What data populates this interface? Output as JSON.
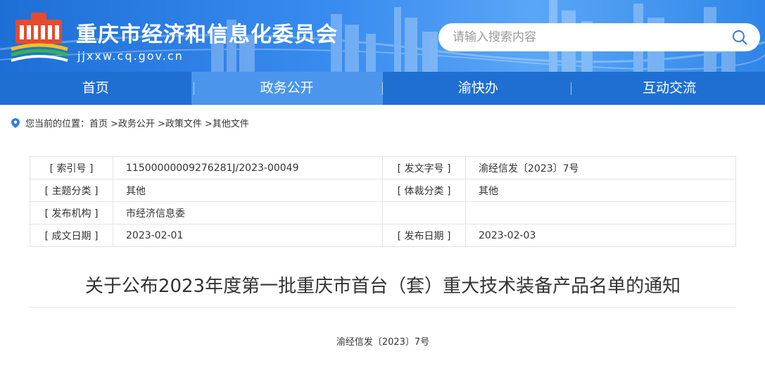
{
  "header": {
    "title": "重庆市经济和信息化委员会",
    "domain": "jjxxw.cq.gov.cn",
    "search_placeholder": "请输入搜索内容"
  },
  "nav": {
    "items": [
      {
        "label": "首页"
      },
      {
        "label": "政务公开"
      },
      {
        "label": "渝快办"
      },
      {
        "label": "互动交流"
      }
    ],
    "active_index": 1
  },
  "breadcrumb": {
    "prefix": "您当前的位置：",
    "items": [
      "首页",
      ">政务公开",
      ">政策文件",
      ">其他文件"
    ]
  },
  "info": {
    "rows": [
      {
        "label1": "[ 索引号 ]",
        "value1": "11500000009276281J/2023-00049",
        "label2": "[ 发文字号 ]",
        "value2": "渝经信发〔2023〕7号"
      },
      {
        "label1": "[ 主题分类 ]",
        "value1": "其他",
        "label2": "[ 体裁分类 ]",
        "value2": "其他"
      },
      {
        "label1": "[ 发布机构 ]",
        "value1": "市经济信息委",
        "label2": "",
        "value2": ""
      },
      {
        "label1": "[ 成文日期 ]",
        "value1": "2023-02-01",
        "label2": "[ 发布日期 ]",
        "value2": "2023-02-03"
      }
    ]
  },
  "article": {
    "title": "关于公布2023年度第一批重庆市首台（套）重大技术装备产品名单的通知",
    "doc_number": "渝经信发〔2023〕7号"
  },
  "colors": {
    "header_blue": "#1f6fd3",
    "nav_active": "#4b96ec",
    "text": "#333333",
    "border": "#e3e3e3"
  },
  "icons": {
    "search": "search-icon",
    "location": "location-pin-icon",
    "logo": "site-logo"
  }
}
